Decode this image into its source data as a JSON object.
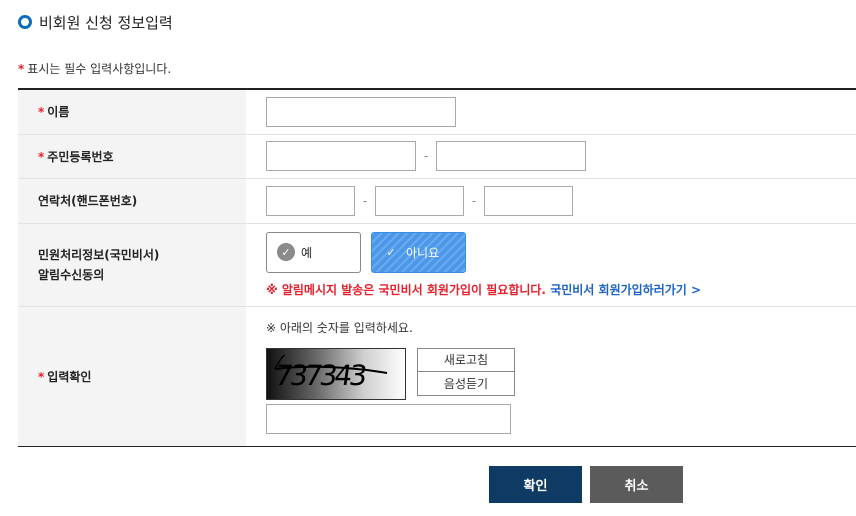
{
  "page": {
    "title": "비회원 신청 정보입력",
    "required_note_mark": "*",
    "required_note": "표시는 필수 입력사항입니다."
  },
  "form": {
    "required_mark": "*",
    "name_label": "이름",
    "rrn_label": "주민등록번호",
    "phone_label": "연락처(핸드폰번호)",
    "consent_label_line1": "민원처리정보(국민비서)",
    "consent_label_line2": "알림수신동의",
    "consent_yes": "예",
    "consent_no": "아니요",
    "notice_text": "※ 알림메시지 발송은 국민비서 회원가입이 필요합니다.",
    "notice_link": "국민비서 회원가입하러가기 >",
    "captcha_label": "입력확인",
    "captcha_guide": "※ 아래의 숫자를 입력하세요.",
    "captcha_value": "737343",
    "refresh_button": "새로고침",
    "audio_button": "음성듣기"
  },
  "dash": "-",
  "buttons": {
    "confirm": "확인",
    "cancel": "취소"
  },
  "colors": {
    "accent_blue": "#0a6ebd",
    "required_red": "#e5202d",
    "link_blue": "#1e63c4",
    "selected_button": "#4b97ea",
    "confirm_button": "#0f3a63",
    "cancel_button": "#5b5b5b"
  }
}
